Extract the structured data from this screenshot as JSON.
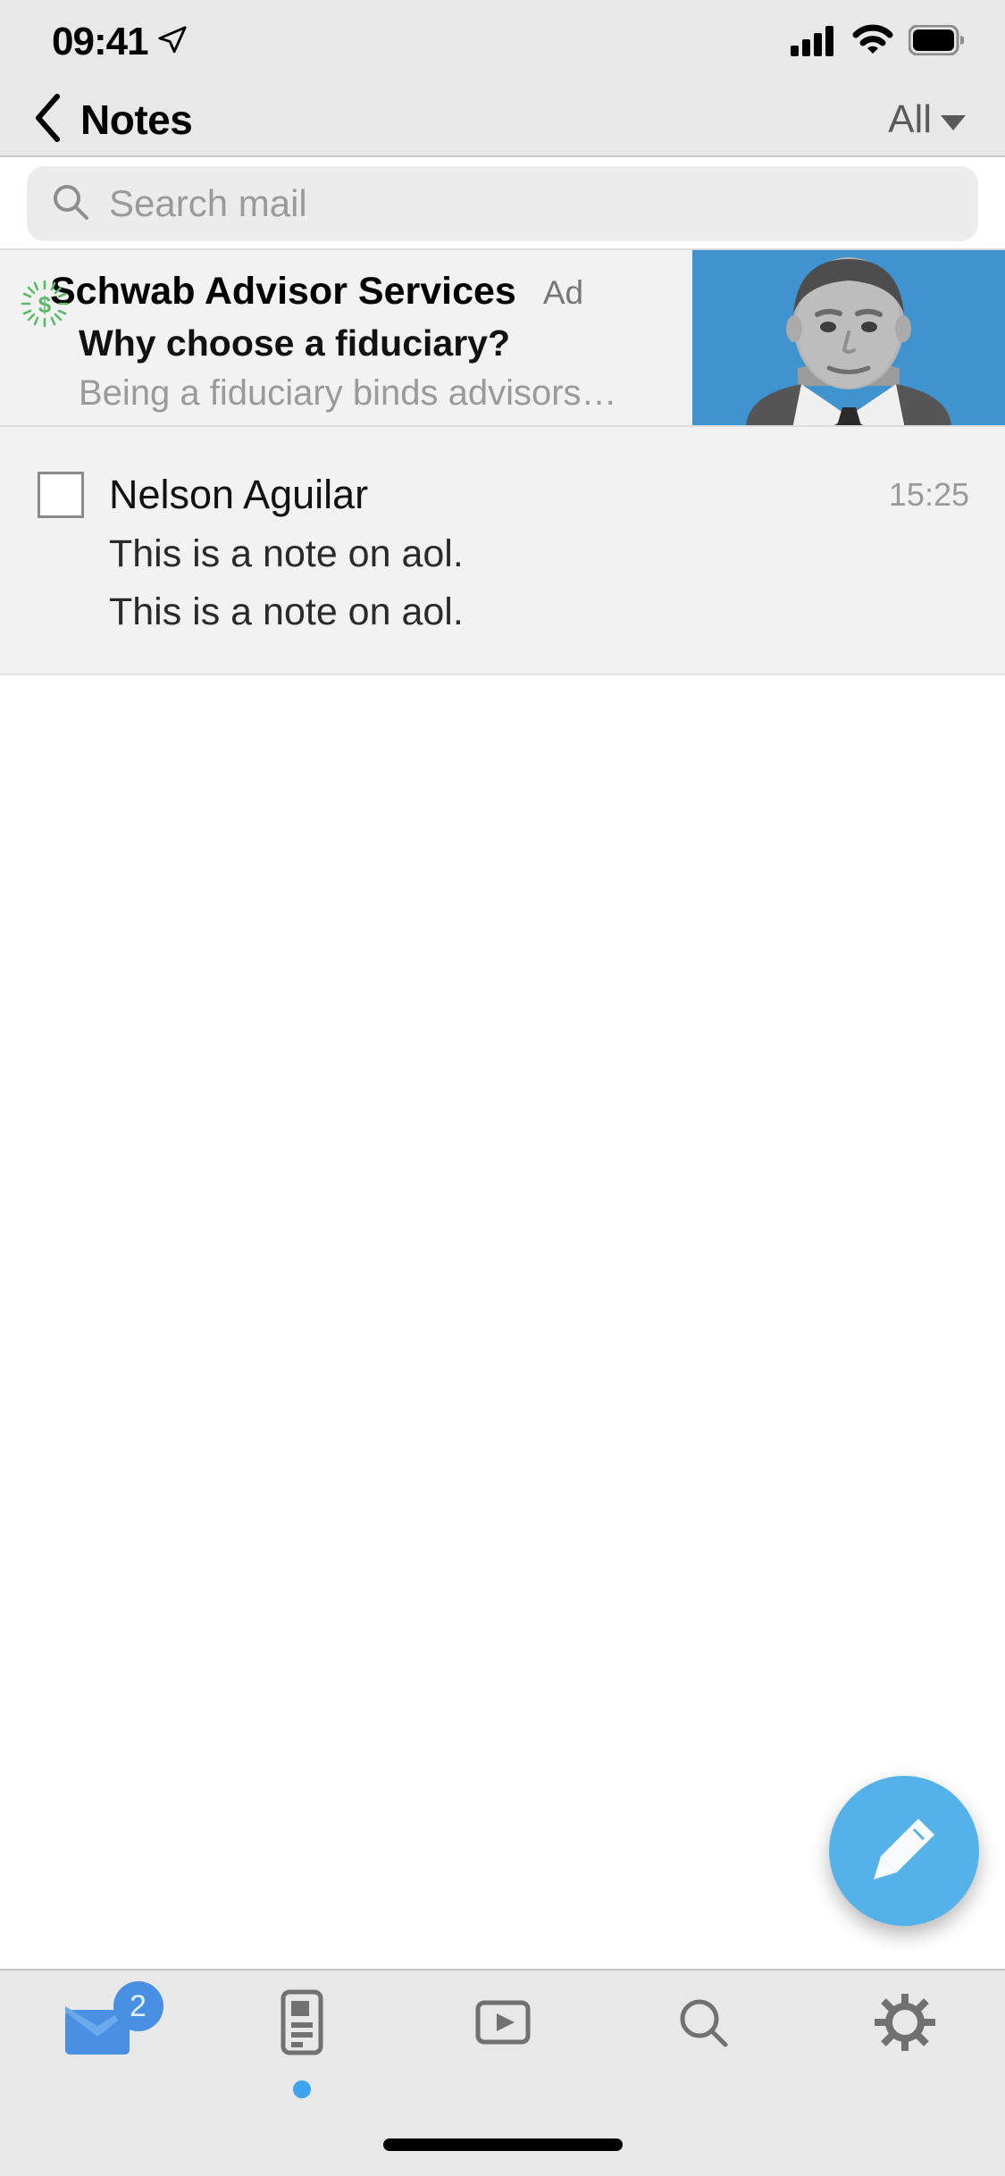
{
  "status_bar": {
    "time": "09:41",
    "location_icon": "location-arrow-icon",
    "signal_icon": "cellular-signal-icon",
    "wifi_icon": "wifi-icon",
    "battery_icon": "battery-full-icon"
  },
  "nav_bar": {
    "back_icon": "chevron-left-icon",
    "title": "Notes",
    "filter_label": "All",
    "filter_caret_icon": "chevron-down-icon"
  },
  "search": {
    "icon": "search-icon",
    "placeholder": "Search mail",
    "value": ""
  },
  "messages": {
    "ad": {
      "icon": "green-dollar-sunburst-icon",
      "sender": "Schwab Advisor Services",
      "badge": "Ad",
      "subject": "Why choose a fiduciary?",
      "preview": "Being a fiduciary binds advisors…",
      "thumbnail": "advisor-headshot-image",
      "thumbnail_bg": "#3f93cf"
    },
    "items": [
      {
        "checked": false,
        "sender": "Nelson Aguilar",
        "time": "15:25",
        "line1": "This is a note on aol.",
        "line2": "This is a note on aol."
      }
    ]
  },
  "compose": {
    "icon": "pencil-icon",
    "color": "#55b2e8"
  },
  "tab_bar": {
    "tabs": [
      {
        "name": "mail",
        "icon": "mail-envelope-icon",
        "badge": "2",
        "active": true,
        "indicator": false
      },
      {
        "name": "news",
        "icon": "news-article-icon",
        "badge": "",
        "active": false,
        "indicator": true
      },
      {
        "name": "video",
        "icon": "video-play-icon",
        "badge": "",
        "active": false,
        "indicator": false
      },
      {
        "name": "search",
        "icon": "search-icon",
        "badge": "",
        "active": false,
        "indicator": false
      },
      {
        "name": "settings",
        "icon": "gear-icon",
        "badge": "",
        "active": false,
        "indicator": false
      }
    ],
    "accent_color": "#4a90e2"
  }
}
